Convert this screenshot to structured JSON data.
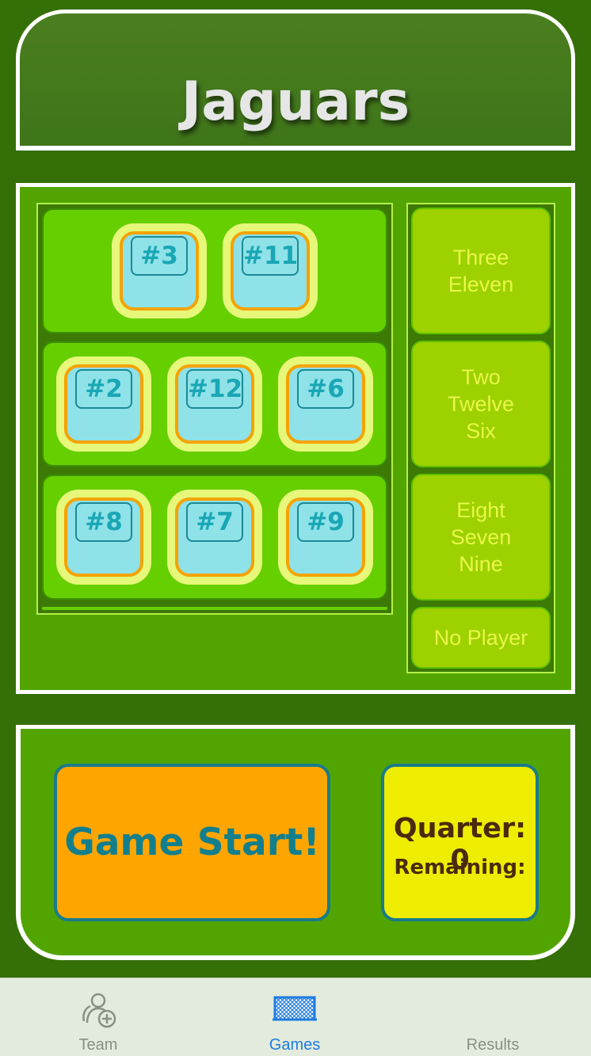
{
  "header": {
    "title": "Jaguars"
  },
  "lineups": [
    {
      "players": [
        "#3",
        "#11"
      ]
    },
    {
      "players": [
        "#2",
        "#12",
        "#6"
      ]
    },
    {
      "players": [
        "#8",
        "#7",
        "#9"
      ]
    }
  ],
  "lines": [
    {
      "label": "Three\nEleven"
    },
    {
      "label": "Two\nTwelve\nSix"
    },
    {
      "label": "Eight\nSeven\nNine"
    },
    {
      "label": "No Player"
    }
  ],
  "controls": {
    "start_label": "Game Start!",
    "quarter_label": "Quarter: 0",
    "remaining_label": "Remaining:"
  },
  "tabbar": {
    "items": [
      {
        "label": "Team",
        "icon": "team-add-icon"
      },
      {
        "label": "Games",
        "icon": "goal-net-icon"
      },
      {
        "label": "Results",
        "icon": "results-icon"
      }
    ],
    "active": "Games"
  },
  "colors": {
    "background": "#356f07",
    "panel": "#52a500",
    "row": "#66cf00",
    "line_button": "#9ed100",
    "start_button": "#ffa500",
    "quarter_box": "#eeec00",
    "active_tab": "#1f7ce0"
  }
}
